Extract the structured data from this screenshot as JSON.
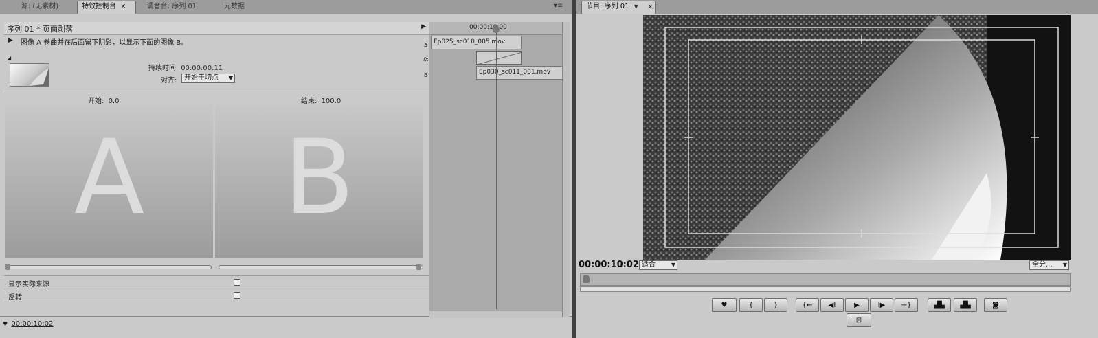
{
  "left_panel": {
    "tabs": [
      {
        "label": "源: (无素材)"
      },
      {
        "label": "特效控制台"
      },
      {
        "label": "调音台: 序列 01"
      },
      {
        "label": "元数据"
      }
    ],
    "effect_header": "序列 01 * 页面剥落",
    "description": "图像 A 卷曲并在后面留下阴影，以显示下面的图像 B。",
    "duration_label": "持续时间",
    "duration_value": "00:00:00:11",
    "align_label": "对齐:",
    "align_value": "开始于切点",
    "start_label": "开始:",
    "start_value": "0.0",
    "end_label": "结束:",
    "end_value": "100.0",
    "preview_a_letter": "A",
    "preview_b_letter": "B",
    "show_actual_sources": "显示实际来源",
    "reverse": "反转",
    "bottom_timecode": "00:00:10:02",
    "track_labels": {
      "a": "A",
      "fx": "fx",
      "b": "B"
    }
  },
  "timeline": {
    "timecode": "00:00:10:00",
    "clip_a": "Ep025_sc010_005.mov",
    "clip_b": "Ep030_sc011_001.mov"
  },
  "program_panel": {
    "tab_label": "节目: 序列 01",
    "timecode": "00:00:10:02",
    "fit_label": "适合",
    "quality_label": "全分..."
  },
  "colors": {
    "panel": "#cacaca",
    "preview_bg_top": "#c6c6c6",
    "preview_bg_bottom": "#9a9a9a",
    "title_safe_line": "#dddddd"
  }
}
